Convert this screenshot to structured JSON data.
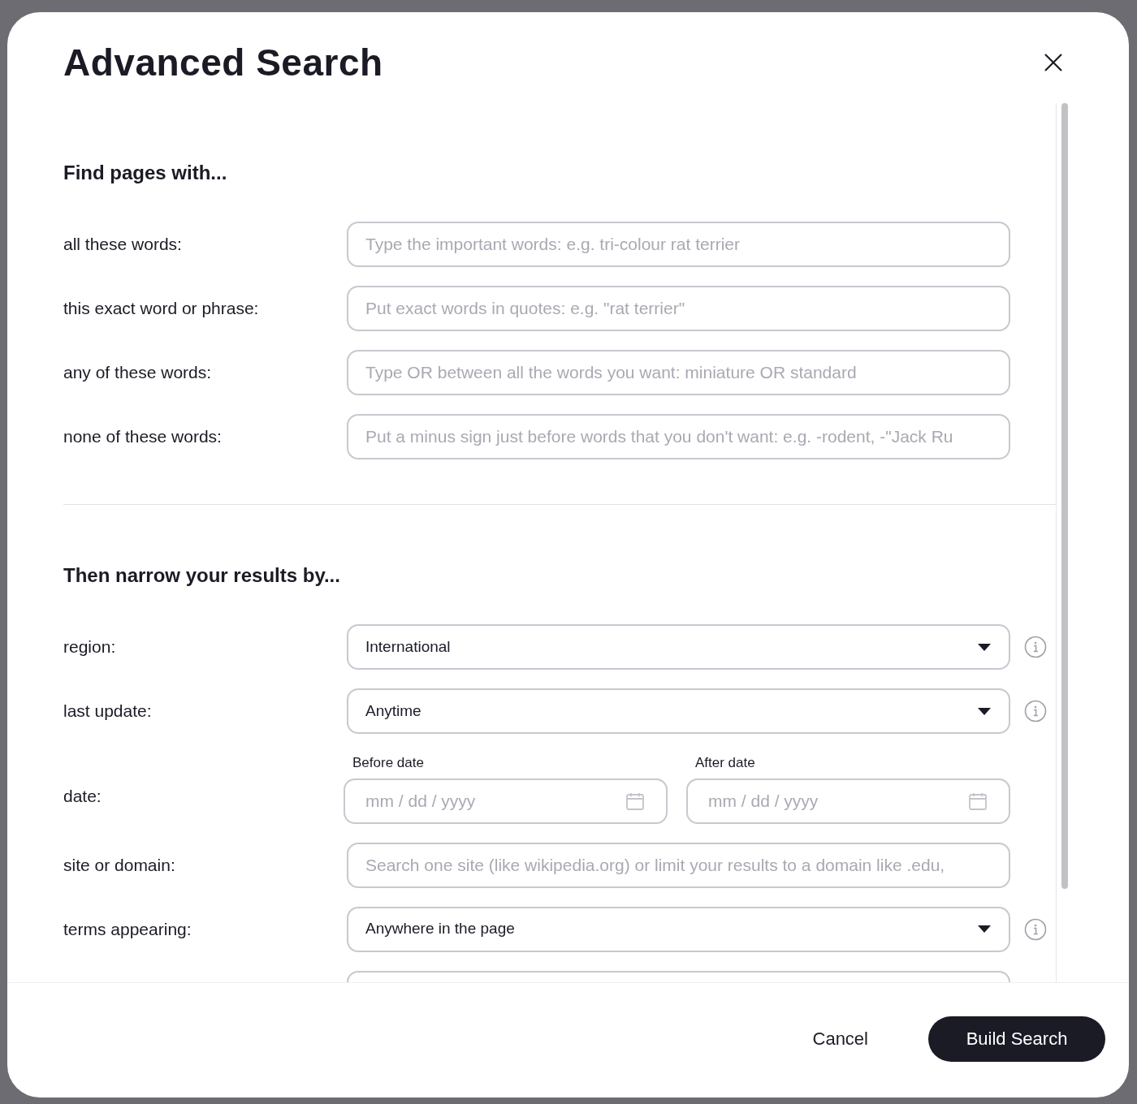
{
  "dialog": {
    "title": "Advanced Search",
    "sections": [
      {
        "title": "Find pages with...",
        "rows": [
          {
            "kind": "text",
            "label": "all these words:",
            "placeholder": "Type the important words: e.g. tri-colour rat terrier"
          },
          {
            "kind": "text",
            "label": "this exact word or phrase:",
            "placeholder": "Put exact words in quotes: e.g. \"rat terrier\""
          },
          {
            "kind": "text",
            "label": "any of these words:",
            "placeholder": "Type OR between all the words you want: miniature OR standard"
          },
          {
            "kind": "text",
            "label": "none of these words:",
            "placeholder": "Put a minus sign just before words that you don't want: e.g. -rodent, -\"Jack Ru"
          }
        ]
      },
      {
        "title": "Then narrow your results by...",
        "rows": [
          {
            "kind": "select",
            "label": "region:",
            "value": "International",
            "info": true
          },
          {
            "kind": "select",
            "label": "last update:",
            "value": "Anytime",
            "info": true
          },
          {
            "kind": "dates",
            "label": "date:",
            "fields": [
              {
                "label": "Before date",
                "placeholder": "mm / dd / yyyy"
              },
              {
                "label": "After date",
                "placeholder": "mm / dd / yyyy"
              }
            ]
          },
          {
            "kind": "text",
            "label": "site or domain:",
            "placeholder": "Search one site (like wikipedia.org) or limit your results to a domain like .edu,"
          },
          {
            "kind": "select",
            "label": "terms appearing:",
            "value": "Anywhere in the page",
            "info": true
          }
        ]
      }
    ],
    "buttons": [
      {
        "kind": "plain",
        "label": "Cancel"
      },
      {
        "kind": "primary",
        "label": "Build Search"
      }
    ]
  }
}
